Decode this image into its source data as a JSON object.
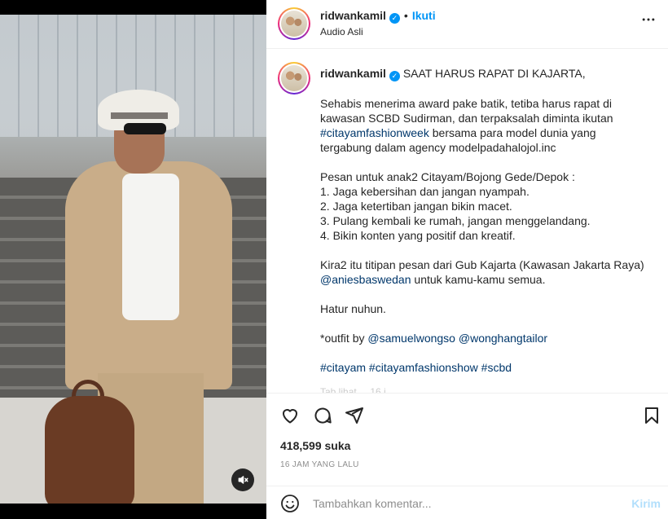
{
  "post": {
    "username": "ridwankamil",
    "follow_label": "Ikuti",
    "audio_label": "Audio Asli",
    "more_icon": "more-horizontal-icon",
    "verified_icon": "verified-badge-icon"
  },
  "caption": {
    "username": "ridwankamil",
    "title": "SAAT HARUS RAPAT DI KAJARTA,",
    "para1": "Sehabis menerima award pake batik, tetiba harus rapat di kawasan SCBD Sudirman, dan terpaksalah diminta ikutan",
    "para1_tag": "#citayamfashionweek",
    "para1_rest": "bersama para model dunia yang tergabung dalam agency modelpadahalojol.inc",
    "list_title": "Pesan untuk anak2 Citayam/Bojong Gede/Depok :",
    "items": [
      "1. Jaga kebersihan dan jangan nyampah.",
      "2. Jaga ketertiban jangan bikin macet.",
      "3. Pulang kembali ke rumah, jangan menggelandang.",
      "4. Bikin konten yang positif dan kreatif."
    ],
    "para2": "Kira2 itu titipan pesan dari Gub Kajarta (Kawasan Jakarta Raya)",
    "para2_mention": "@aniesbaswedan",
    "para2_rest": "untuk kamu-kamu semua.",
    "thanks": "Hatur nuhun.",
    "outfit_label": "*outfit by",
    "outfit_mention1": "@samuelwongso",
    "outfit_mention2": "@wonghangtailor",
    "hashtags": [
      "#citayam",
      "#citayamfashionshow",
      "#scbd"
    ],
    "faded_line": "Tab lihat ... 16 j..."
  },
  "actions": {
    "like_icon": "heart-icon",
    "comment_icon": "comment-bubble-icon",
    "share_icon": "send-paper-plane-icon",
    "save_icon": "bookmark-icon"
  },
  "likes": "418,599 suka",
  "timestamp": "16 JAM YANG LALU",
  "comment": {
    "placeholder": "Tambahkan komentar...",
    "send_label": "Kirim",
    "emoji_icon": "emoji-smile-icon"
  },
  "media": {
    "mute_icon": "speaker-muted-icon"
  },
  "colors": {
    "accent": "#0095f6",
    "text": "#262626",
    "muted": "#8e8e8e",
    "link": "#00376b",
    "send_disabled": "#b2dffc"
  }
}
